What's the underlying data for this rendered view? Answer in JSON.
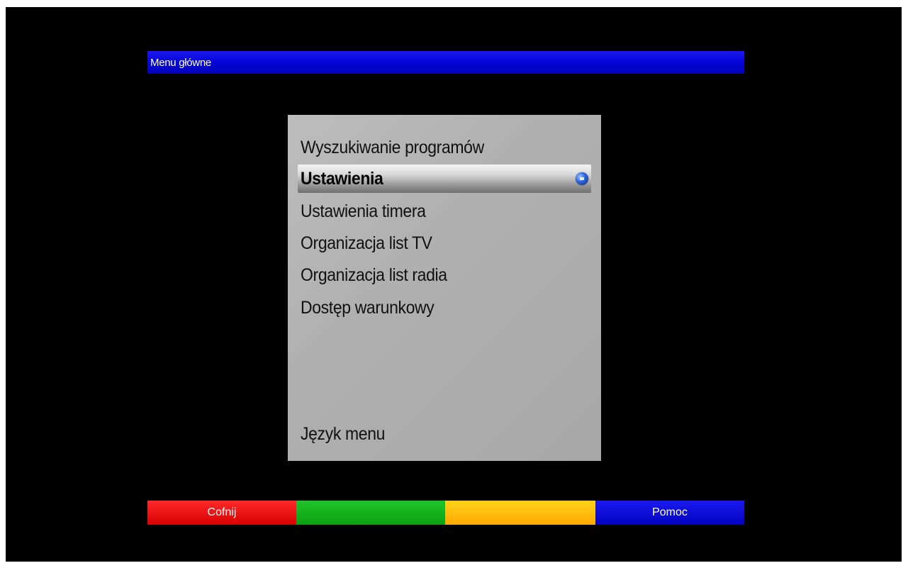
{
  "header": {
    "title": "Menu główne"
  },
  "menu": {
    "items": [
      {
        "label": "Wyszukiwanie programów",
        "selected": false
      },
      {
        "label": "Ustawienia",
        "selected": true
      },
      {
        "label": "Ustawienia timera",
        "selected": false
      },
      {
        "label": "Organizacja list TV",
        "selected": false
      },
      {
        "label": "Organizacja list radia",
        "selected": false
      },
      {
        "label": "Dostęp warunkowy",
        "selected": false
      },
      {
        "label": "Język menu",
        "selected": false
      }
    ],
    "selected_icon": "ok-icon"
  },
  "footer": {
    "red_label": "Cofnij",
    "green_label": "",
    "yellow_label": "",
    "blue_label": "Pomoc"
  },
  "colors": {
    "background": "#000000",
    "title_bar": "#0505d8",
    "panel": "#b4b4b4",
    "red": "#e00000",
    "green": "#12b01a",
    "yellow": "#ffbb00",
    "blue": "#0505d8"
  }
}
